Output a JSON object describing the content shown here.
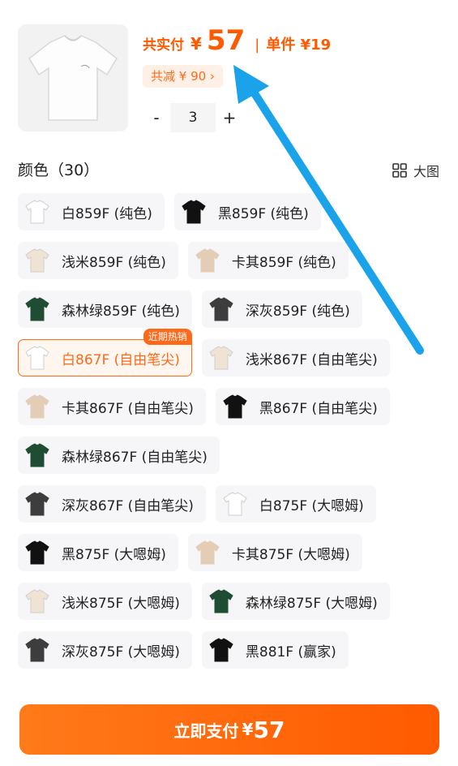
{
  "header": {
    "price_label": "共实付",
    "price_yen": "¥",
    "price_value": "57",
    "separator": "|",
    "unit_price": "单件 ¥19",
    "discount": "共减 ¥ 90 ›",
    "qty_minus": "-",
    "qty_value": "3",
    "qty_plus": "+"
  },
  "colors": {
    "title": "颜色（30）",
    "big_view": "大图",
    "options": [
      {
        "label": "白859F (纯色)",
        "shirt": "#ffffff",
        "row": 0
      },
      {
        "label": "黑859F (纯色)",
        "shirt": "#111111",
        "row": 0
      },
      {
        "label": "浅米859F (纯色)",
        "shirt": "#efe3d3",
        "row": 1
      },
      {
        "label": "卡其859F (纯色)",
        "shirt": "#e3cdb6",
        "row": 1
      },
      {
        "label": "森林绿859F (纯色)",
        "shirt": "#1f4d33",
        "row": 2
      },
      {
        "label": "深灰859F (纯色)",
        "shirt": "#3d3d3d",
        "row": 2
      },
      {
        "label": "白867F (自由笔尖)",
        "shirt": "#ffffff",
        "row": 3,
        "selected": true,
        "badge": "近期热销"
      },
      {
        "label": "浅米867F (自由笔尖)",
        "shirt": "#efe3d3",
        "row": 3
      },
      {
        "label": "卡其867F (自由笔尖)",
        "shirt": "#e3cdb6",
        "row": 4
      },
      {
        "label": "黑867F (自由笔尖)",
        "shirt": "#111111",
        "row": 4
      },
      {
        "label": "森林绿867F (自由笔尖)",
        "shirt": "#1f4d33",
        "row": 5
      },
      {
        "label": "深灰867F (自由笔尖)",
        "shirt": "#3d3d3d",
        "row": 6
      },
      {
        "label": "白875F (大嗯姆)",
        "shirt": "#ffffff",
        "row": 6
      },
      {
        "label": "黑875F (大嗯姆)",
        "shirt": "#111111",
        "row": 7
      },
      {
        "label": "卡其875F (大嗯姆)",
        "shirt": "#e3cdb6",
        "row": 7
      },
      {
        "label": "浅米875F (大嗯姆)",
        "shirt": "#efe3d3",
        "row": 8
      },
      {
        "label": "森林绿875F (大嗯姆)",
        "shirt": "#1f4d33",
        "row": 8
      },
      {
        "label": "深灰875F (大嗯姆)",
        "shirt": "#3d3d3d",
        "row": 9
      },
      {
        "label": "黑881F (赢家)",
        "shirt": "#111111",
        "row": 9
      }
    ]
  },
  "pay": {
    "label": "立即支付",
    "yen": "¥",
    "value": "57"
  },
  "theme": {
    "accent": "#ff5a00",
    "arrow": "#1aa3ea"
  }
}
